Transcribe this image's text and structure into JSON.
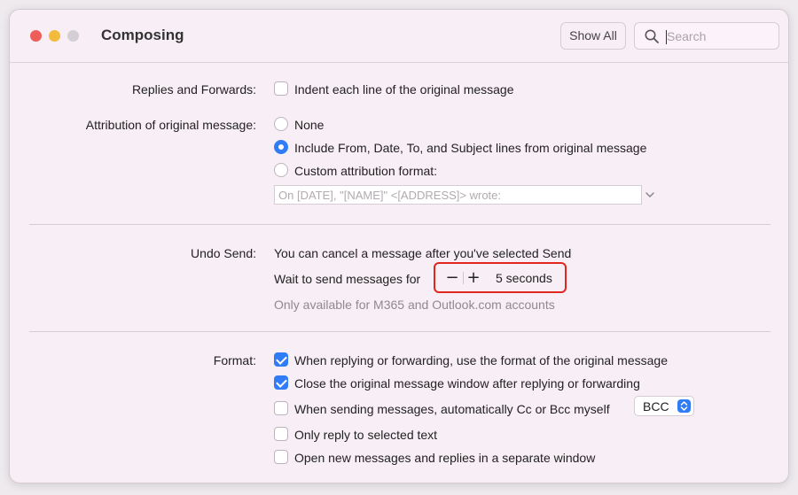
{
  "window": {
    "title": "Composing"
  },
  "toolbar": {
    "show_all": "Show All",
    "search_placeholder": "Search"
  },
  "replies": {
    "label": "Replies and Forwards:",
    "indent_label": "Indent each line of the original message",
    "indent_checked": false
  },
  "attribution": {
    "label": "Attribution of original message:",
    "options": [
      {
        "label": "None",
        "selected": false
      },
      {
        "label": "Include From, Date, To, and Subject lines from original message",
        "selected": true
      },
      {
        "label": "Custom attribution format:",
        "selected": false
      }
    ],
    "custom_placeholder": "On [DATE], \"[NAME]\" <[ADDRESS]> wrote:"
  },
  "undo": {
    "label": "Undo Send:",
    "description": "You can cancel a message after you've selected Send",
    "wait_label": "Wait to send messages for",
    "minus": "−",
    "plus": "+",
    "value": "5 seconds",
    "note": "Only available for M365 and Outlook.com accounts"
  },
  "format": {
    "label": "Format:",
    "options": [
      {
        "label": "When replying or forwarding, use the format of the original message",
        "checked": true
      },
      {
        "label": "Close the original message window after replying or forwarding",
        "checked": true
      },
      {
        "label": "When sending messages, automatically Cc or Bcc myself",
        "checked": false
      },
      {
        "label": "Only reply to selected text",
        "checked": false
      },
      {
        "label": "Open new messages and replies in a separate window",
        "checked": false
      }
    ],
    "bcc_value": "BCC"
  },
  "colors": {
    "accent": "#2f7cf6",
    "highlight": "#e0261f"
  }
}
